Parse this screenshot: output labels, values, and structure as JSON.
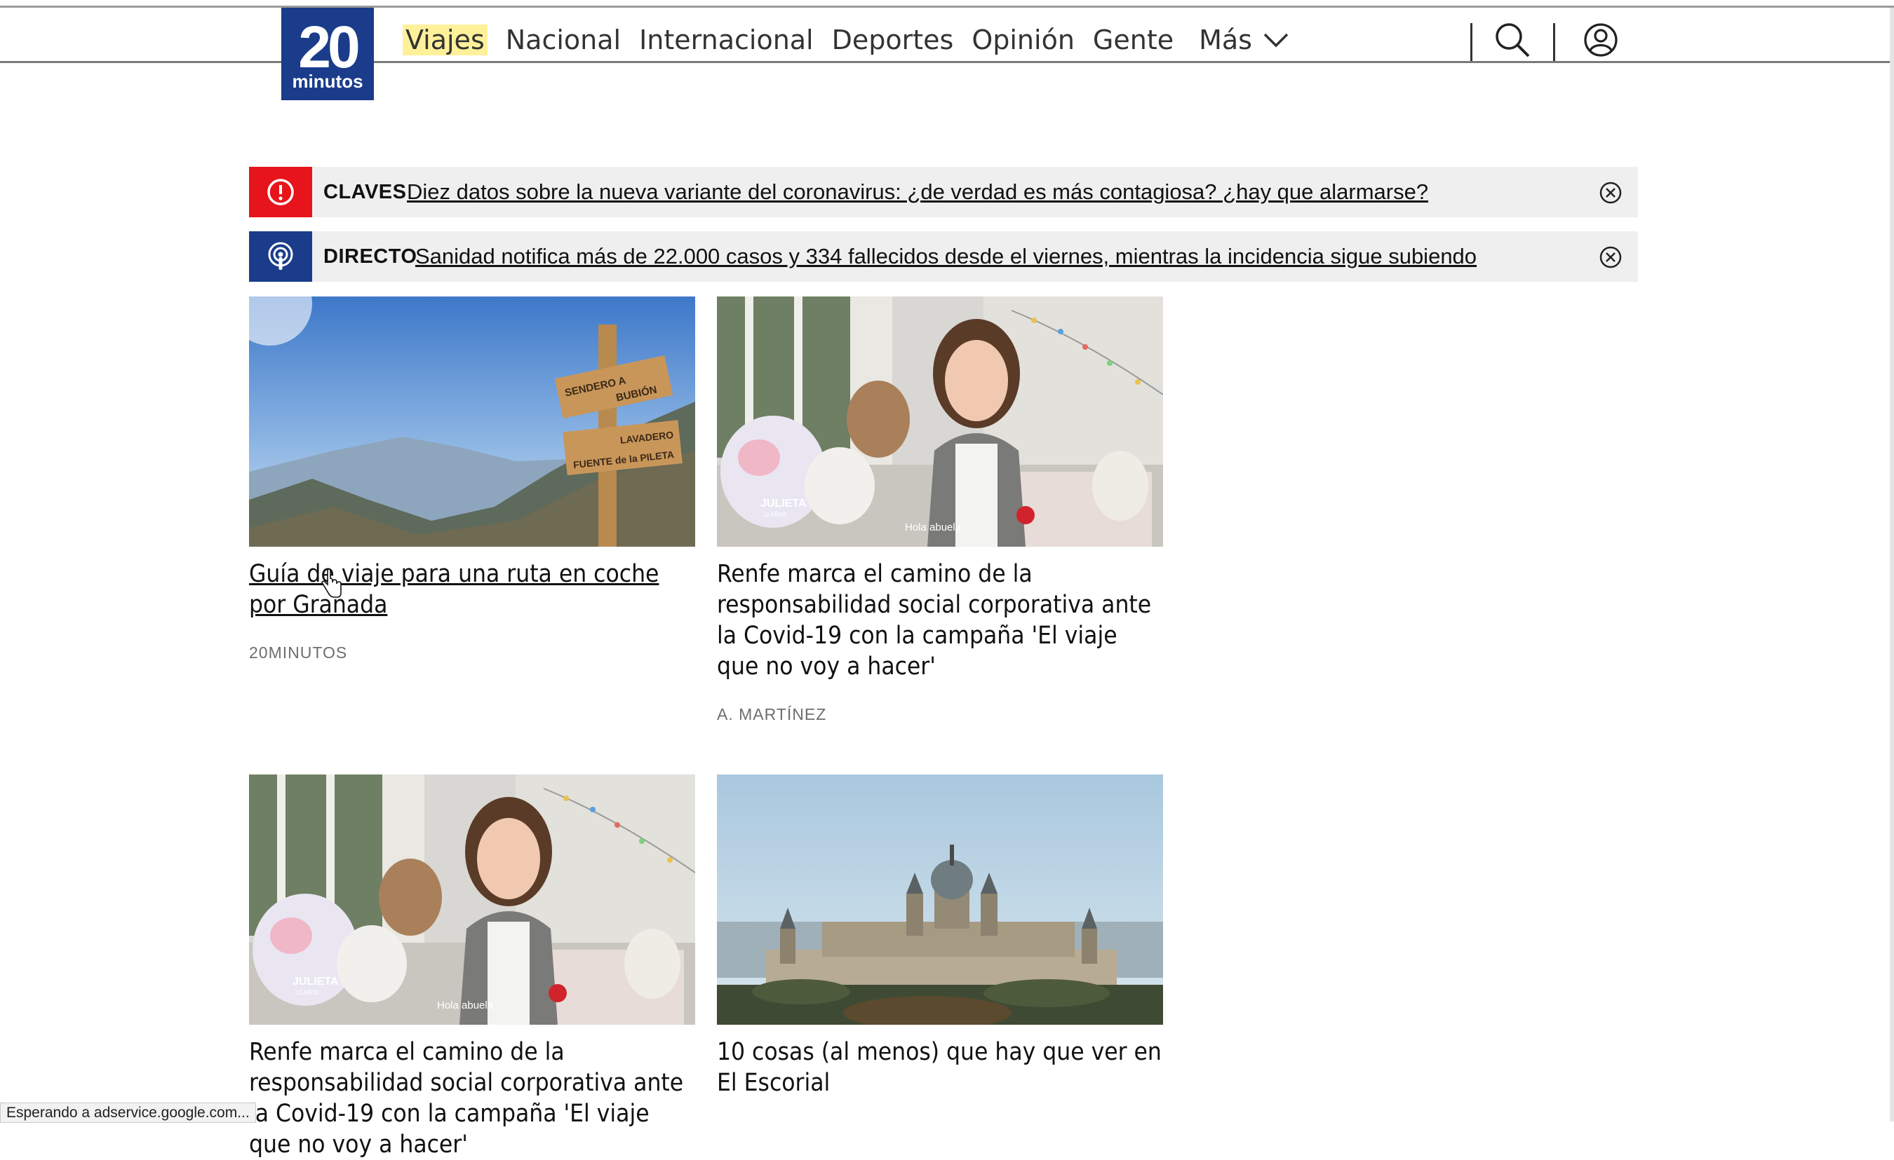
{
  "logo": {
    "big": "20",
    "small": "minutos"
  },
  "nav": {
    "items": [
      "Viajes",
      "Nacional",
      "Internacional",
      "Deportes",
      "Opinión",
      "Gente"
    ],
    "more_label": "Más"
  },
  "icons": {
    "search": "search-icon",
    "user": "user-icon",
    "more": "chevron-down-icon"
  },
  "alerts": [
    {
      "label": "CLAVES",
      "text": "Diez datos sobre la nueva variante del coronavirus: ¿de verdad es más contagiosa? ¿hay que alarmarse?",
      "color": "#e8141b",
      "icon": "exclamation-icon"
    },
    {
      "label": "DIRECTO",
      "text": "Sanidad notifica más de 22.000 casos y 334 fallecidos desde el viernes, mientras la incidencia sigue subiendo",
      "color": "#1a3c8a",
      "icon": "podcast-icon"
    }
  ],
  "cards": [
    {
      "title": "Guía de viaje para una ruta en coche por Granada",
      "author": "20MINUTOS",
      "image": "mountain-signpost-photo"
    },
    {
      "title": "Renfe marca el camino de la responsabilidad social corporativa ante la Covid-19 con la campaña 'El viaje que no voy a hacer'",
      "author": "A. MARTÍNEZ",
      "image": "girl-with-toys-photo"
    },
    {
      "title": "Renfe marca el camino de la responsabilidad social corporativa ante la Covid-19 con la campaña 'El viaje que no voy a hacer'",
      "author": "",
      "image": "girl-with-toys-photo"
    },
    {
      "title": "10 cosas (al menos) que hay que ver en El Escorial",
      "author": "",
      "image": "el-escorial-photo"
    }
  ],
  "photo_text": {
    "sign_top_1": "SENDERO A",
    "sign_top_2": "BUBIÓN",
    "sign_bottom_1": "LAVADERO",
    "sign_bottom_2": "FUENTE de la PILETA",
    "girl_name": "JULIETA",
    "girl_age": "12 AÑOS",
    "girl_caption": "Hola abuela"
  },
  "status_bar": "Esperando a adservice.google.com..."
}
